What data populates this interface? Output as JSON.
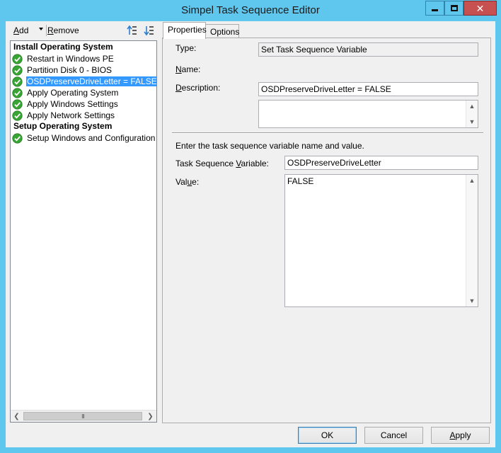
{
  "window": {
    "title": "Simpel Task Sequence Editor"
  },
  "toolbar": {
    "add_label": "dd",
    "add_accel": "A",
    "remove_label": "emove",
    "remove_accel": "R"
  },
  "tree": {
    "groups": [
      {
        "name": "Install Operating System",
        "steps": [
          {
            "label": "Restart in Windows PE",
            "selected": false
          },
          {
            "label": "Partition Disk 0 - BIOS",
            "selected": false
          },
          {
            "label": "OSDPreserveDriveLetter = FALSE",
            "selected": true
          },
          {
            "label": "Apply Operating System",
            "selected": false
          },
          {
            "label": "Apply Windows Settings",
            "selected": false
          },
          {
            "label": "Apply Network Settings",
            "selected": false
          }
        ]
      },
      {
        "name": "Setup Operating System",
        "steps": [
          {
            "label": "Setup Windows and Configuration Mar",
            "selected": false
          }
        ]
      }
    ],
    "hscroll_thumb": "III"
  },
  "tabs": {
    "properties": "Properties",
    "options": "Options"
  },
  "properties": {
    "type_label": "Type:",
    "type_value": "Set Task Sequence Variable",
    "name_label_accel": "N",
    "name_label": "ame:",
    "name_value": "OSDPreserveDriveLetter = FALSE",
    "description_label_accel": "D",
    "description_label": "escription:",
    "description_value": "",
    "instruction": "Enter the task sequence variable name and value.",
    "variable_label_pre": "Task Sequence ",
    "variable_label_accel": "V",
    "variable_label_post": "ariable:",
    "variable_value": "OSDPreserveDriveLetter",
    "value_label_pre": "Val",
    "value_label_accel": "u",
    "value_label_post": "e:",
    "value_value": "FALSE"
  },
  "buttons": {
    "ok": "OK",
    "cancel": "Cancel",
    "apply_accel": "A",
    "apply": "pply"
  },
  "colors": {
    "title_bar": "#5fc6ee",
    "selection": "#3399ff",
    "success_check": "#3aa335",
    "close_button": "#c75050"
  }
}
